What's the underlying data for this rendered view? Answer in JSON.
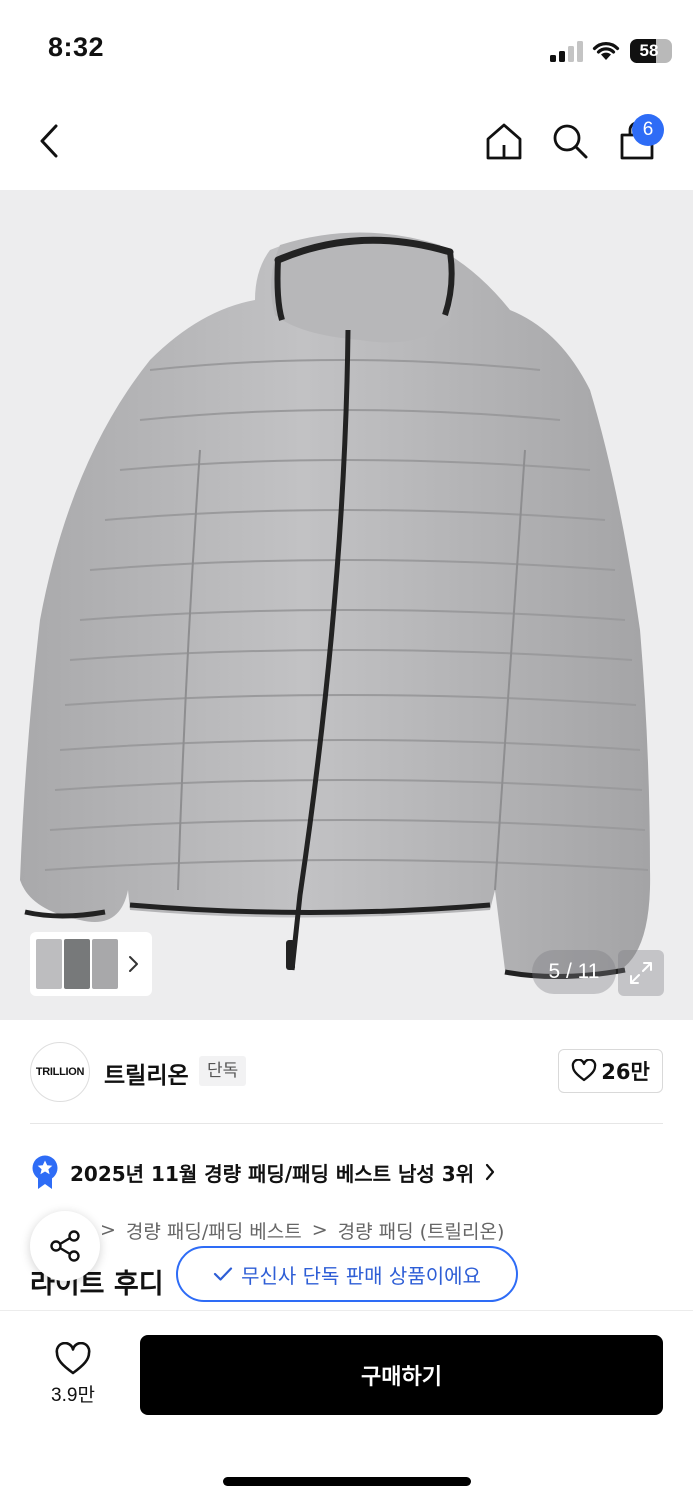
{
  "status_bar": {
    "time": "8:32",
    "battery_level": "58",
    "battery_fraction": 0.58,
    "icons": [
      "cellular-signal-icon",
      "wifi-icon",
      "battery-icon"
    ]
  },
  "nav": {
    "icons": [
      "back-chevron-icon",
      "home-icon",
      "search-icon",
      "shopping-bag-icon"
    ],
    "cart_count": "6"
  },
  "gallery": {
    "image_index": "5 / 11",
    "icons": [
      "expand-icon",
      "chevron-right-icon"
    ],
    "background_color": "#ededee"
  },
  "brand": {
    "logo_text": "TRILLION",
    "name": "트릴리온",
    "badge": "단독",
    "like_count": "26만"
  },
  "ranking": {
    "text": "2025년 11월 경량 패딩/패딩 베스트 남성 3위",
    "icon": "ranking-badge-icon"
  },
  "breadcrumb": {
    "items": [
      "경량 패딩/패딩 베스트",
      "경량 패딩 (트릴리온)"
    ],
    "separator": ">"
  },
  "product": {
    "title_visible": "라이트 후디"
  },
  "tooltip": {
    "text": "무신사 단독 판매 상품이에요"
  },
  "bottom_bar": {
    "wish_count": "3.9만",
    "buy_label": "구매하기"
  },
  "colors": {
    "accent": "#2e6cf6",
    "buy_button": "#000000"
  }
}
